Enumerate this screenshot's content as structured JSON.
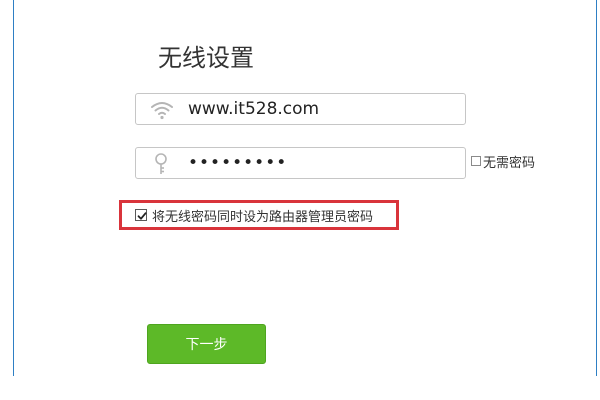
{
  "page": {
    "title": "无线设置"
  },
  "form": {
    "ssid": {
      "value": "www.it528.com",
      "icon": "wifi-icon"
    },
    "password": {
      "value": "•••••••••",
      "icon": "key-icon"
    },
    "no_password": {
      "label": "无需密码",
      "checked": false
    },
    "set_as_admin": {
      "label": "将无线密码同时设为路由器管理员密码",
      "checked": true,
      "highlight_color": "#d9343b"
    }
  },
  "actions": {
    "next_label": "下一步",
    "next_color": "#5db928"
  },
  "colors": {
    "frame": "#2e7fc4"
  }
}
